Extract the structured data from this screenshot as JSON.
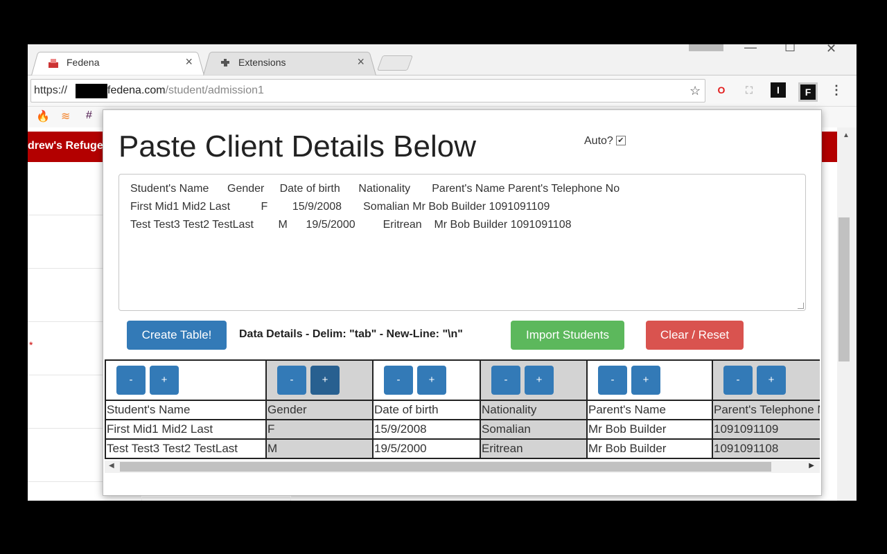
{
  "browser": {
    "tabs": [
      {
        "label": "Fedena",
        "close": "×"
      },
      {
        "label": "Extensions",
        "close": "×"
      }
    ],
    "window_controls": {
      "minimize": "—",
      "maximize": "☐",
      "close": "✕"
    },
    "url": {
      "scheme": "https://",
      "host": "fedena.com",
      "path": "/student/admission1"
    },
    "bookmark_icons": [
      "firebase-icon",
      "stackoverflow-icon",
      "slack-icon"
    ],
    "extension_icons": [
      "opera-icon",
      "puzzle-extension-icon",
      "instapaper-icon",
      "fedena-extension-icon"
    ],
    "extension_glyphs": {
      "opera": "O",
      "puzzle": "⛶",
      "instapaper": "I",
      "fedena": "F"
    }
  },
  "page": {
    "header_text": "drew's Refugee",
    "required_marker": "*"
  },
  "popup": {
    "title": "Paste Client Details Below",
    "auto_label": "Auto?",
    "auto_checked": true,
    "auto_check_glyph": "✔",
    "textarea_lines": [
      "Student's Name      Gender     Date of birth      Nationality       Parent's Name Parent's Telephone No",
      "First Mid1 Mid2 Last          F        15/9/2008       Somalian Mr Bob Builder 1091091109",
      "Test Test3 Test2 TestLast        M      19/5/2000         Eritrean    Mr Bob Builder 1091091108"
    ],
    "buttons": {
      "create": "Create Table!",
      "import": "Import Students",
      "clear": "Clear / Reset"
    },
    "data_details": "Data Details - Delim: \"tab\" - New-Line: \"\\n\"",
    "controls": {
      "minus": "-",
      "plus": "+"
    },
    "table": {
      "headers": [
        "Student's Name",
        "Gender",
        "Date of birth",
        "Nationality",
        "Parent's Name",
        "Parent's Telephone No"
      ],
      "rows": [
        [
          "First Mid1 Mid2 Last",
          "F",
          "15/9/2008",
          "Somalian",
          "Mr Bob Builder",
          "1091091109"
        ],
        [
          "Test Test3 Test2 TestLast",
          "M",
          "19/5/2000",
          "Eritrean",
          "Mr Bob Builder",
          "1091091108"
        ]
      ]
    }
  },
  "colors": {
    "primary": "#337ab7",
    "primary_active": "#286090",
    "success": "#5cb85c",
    "danger": "#d9534f",
    "header_red": "#b30000",
    "column_gray": "#d3d3d3"
  }
}
